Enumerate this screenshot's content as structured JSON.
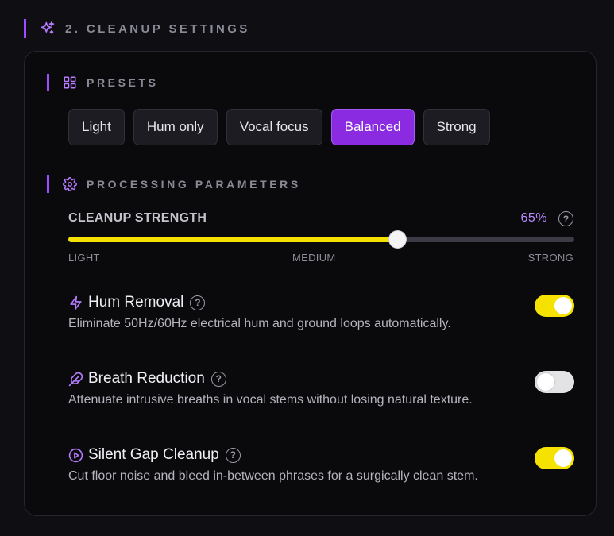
{
  "section": {
    "title": "2. CLEANUP SETTINGS"
  },
  "presets": {
    "header": "PRESETS",
    "items": [
      {
        "label": "Light",
        "active": false
      },
      {
        "label": "Hum only",
        "active": false
      },
      {
        "label": "Vocal focus",
        "active": false
      },
      {
        "label": "Balanced",
        "active": true
      },
      {
        "label": "Strong",
        "active": false
      }
    ]
  },
  "processing": {
    "header": "PROCESSING PARAMETERS",
    "strength": {
      "label": "CLEANUP STRENGTH",
      "value_text": "65%",
      "value": 65,
      "scale": [
        "LIGHT",
        "MEDIUM",
        "STRONG"
      ]
    },
    "options": [
      {
        "icon": "lightning-icon",
        "name": "Hum Removal",
        "description": "Eliminate 50Hz/60Hz electrical hum and ground loops automatically.",
        "enabled": true
      },
      {
        "icon": "feather-icon",
        "name": "Breath Reduction",
        "description": "Attenuate intrusive breaths in vocal stems without losing natural texture.",
        "enabled": false
      },
      {
        "icon": "play-circle-icon",
        "name": "Silent Gap Cleanup",
        "description": "Cut floor noise and bleed in-between phrases for a surgically clean stem.",
        "enabled": true
      }
    ]
  },
  "colors": {
    "accent": "#9b4dff",
    "active_preset": "#8a2be2",
    "slider_fill": "#f5e200",
    "toggle_on": "#f5e200",
    "toggle_off": "#e3e3e6"
  }
}
